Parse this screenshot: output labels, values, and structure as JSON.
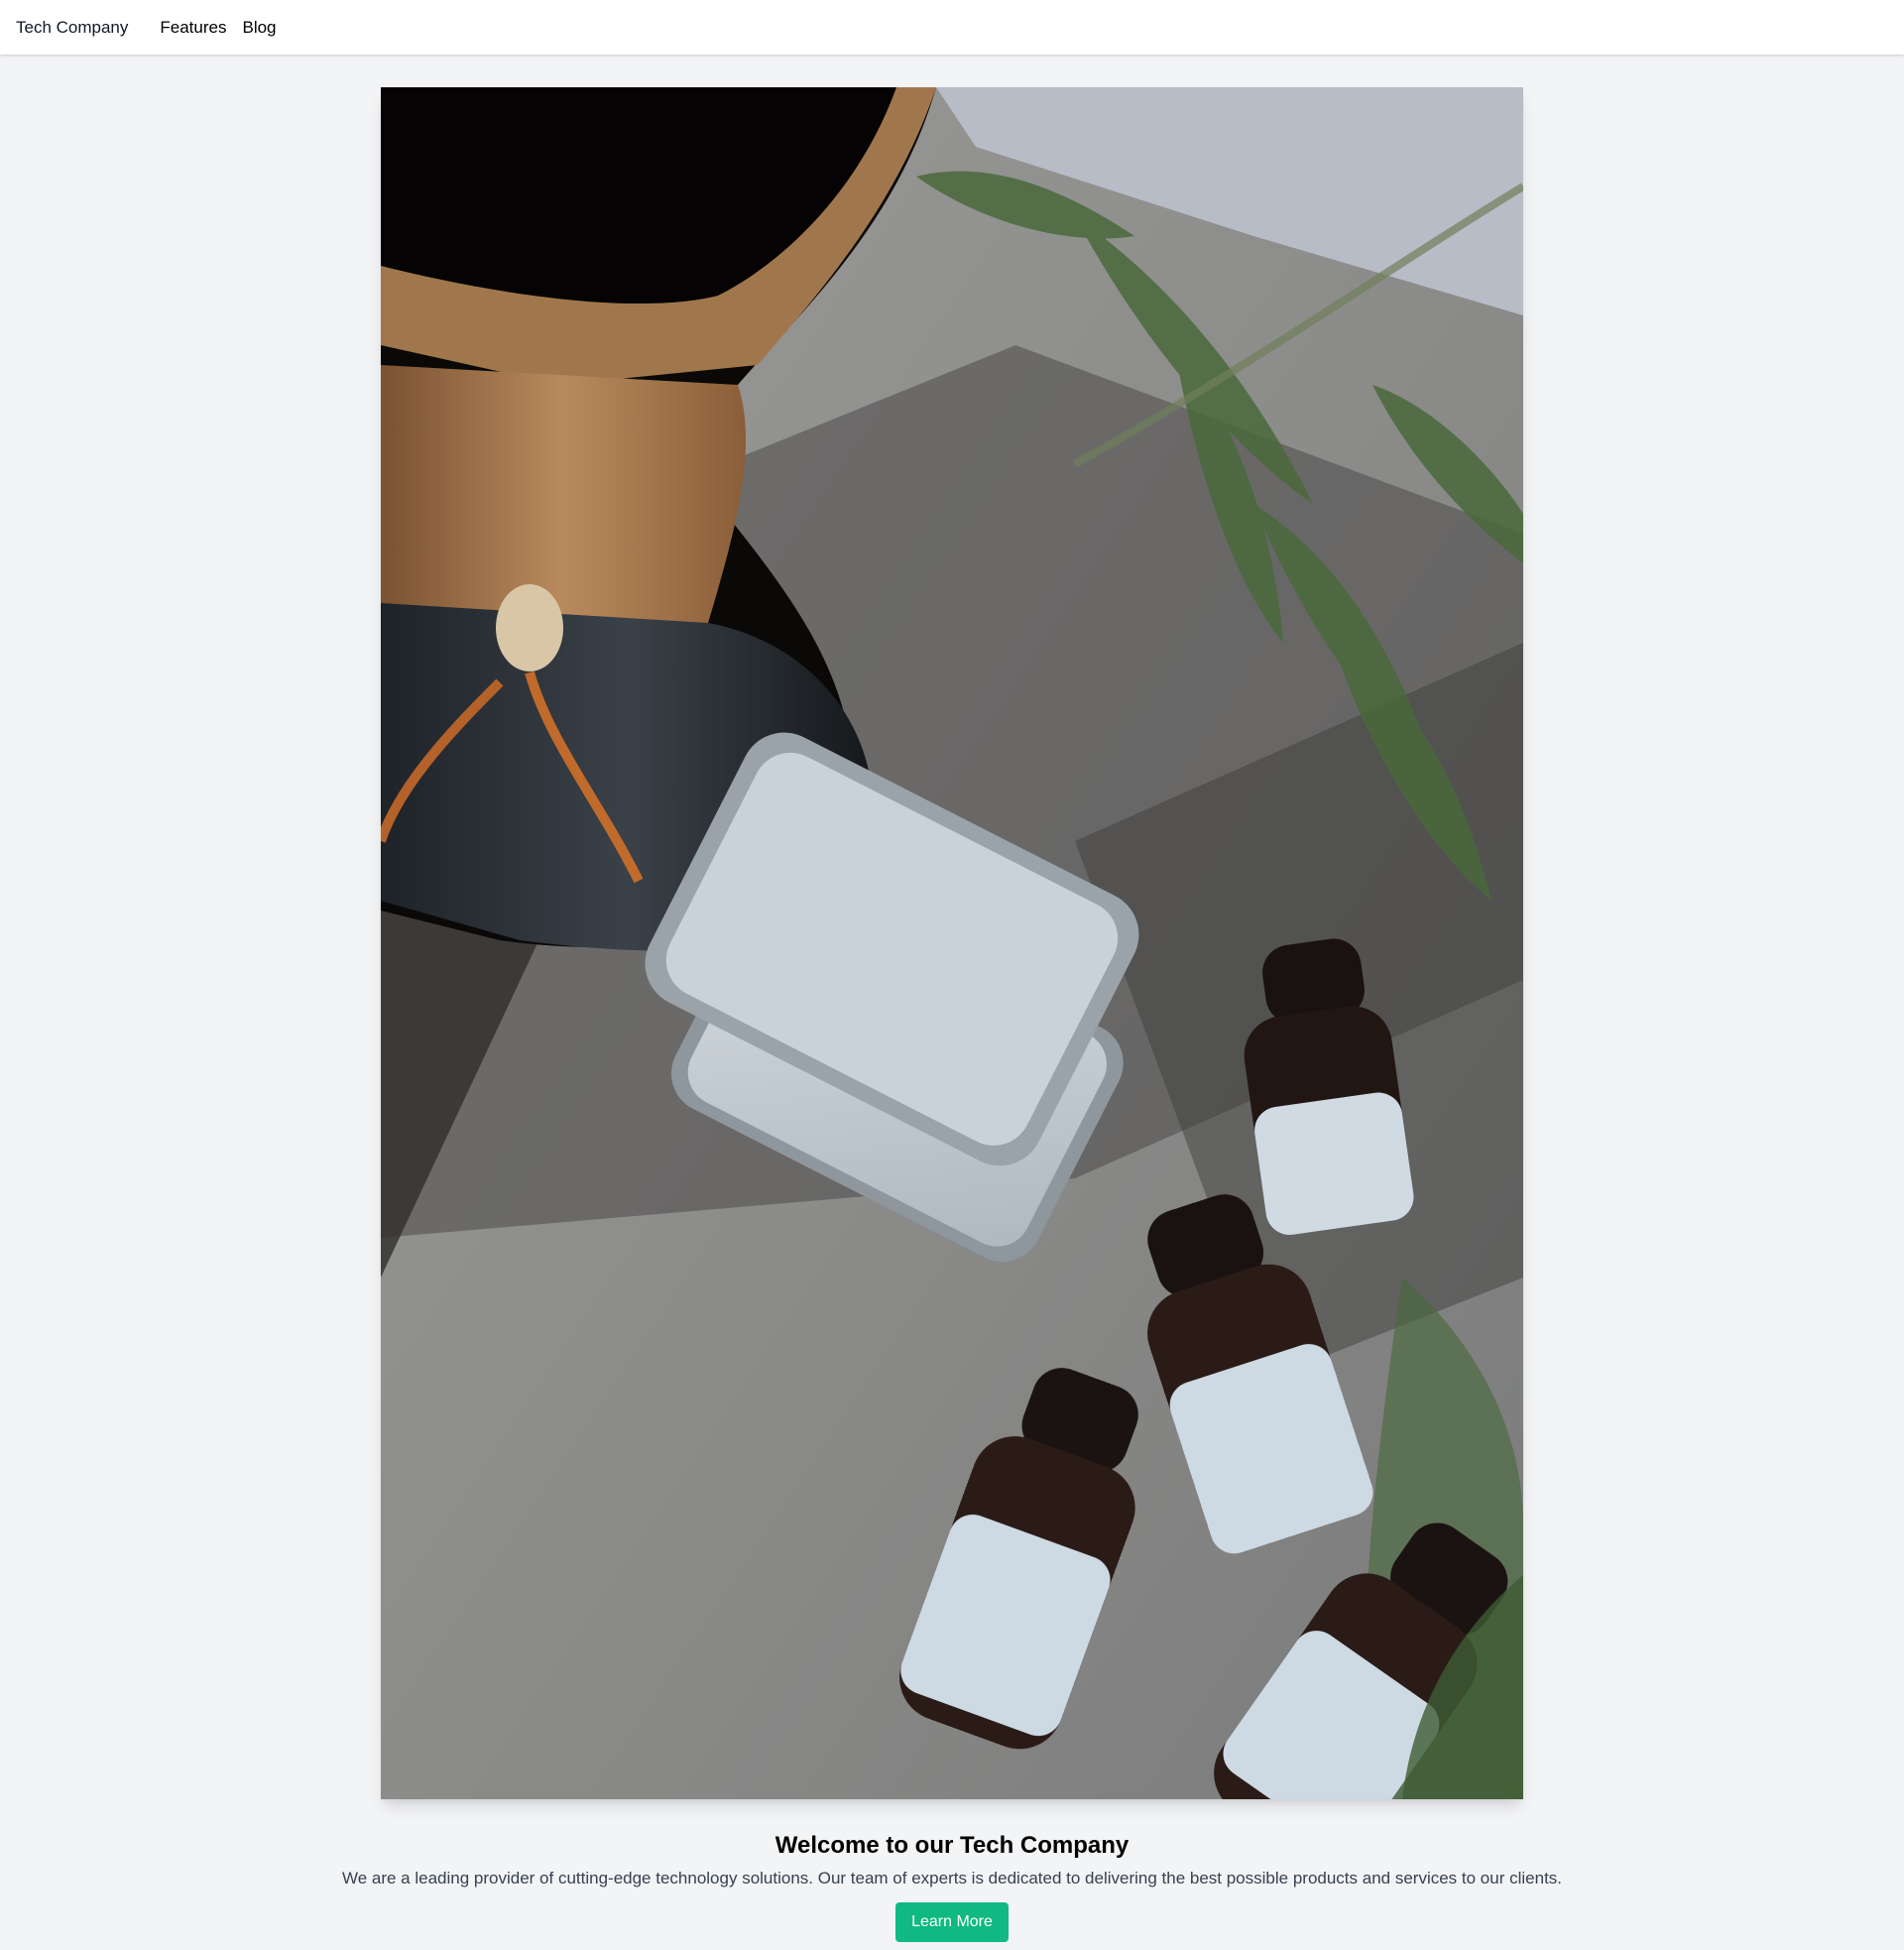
{
  "header": {
    "brand": "Tech Company",
    "nav": [
      {
        "label": "Features"
      },
      {
        "label": "Blog"
      }
    ]
  },
  "hero": {
    "image_icon": "photo-coffee-dripper-tins-bottles"
  },
  "main": {
    "title": "Welcome to our Tech Company",
    "description": "We are a leading provider of cutting-edge technology solutions. Our team of experts is dedicated to delivering the best possible products and services to our clients.",
    "cta_label": "Learn More"
  },
  "colors": {
    "background": "#f3f4f6",
    "header_bg": "#ffffff",
    "accent": "#10b981",
    "body_text": "#374151"
  }
}
